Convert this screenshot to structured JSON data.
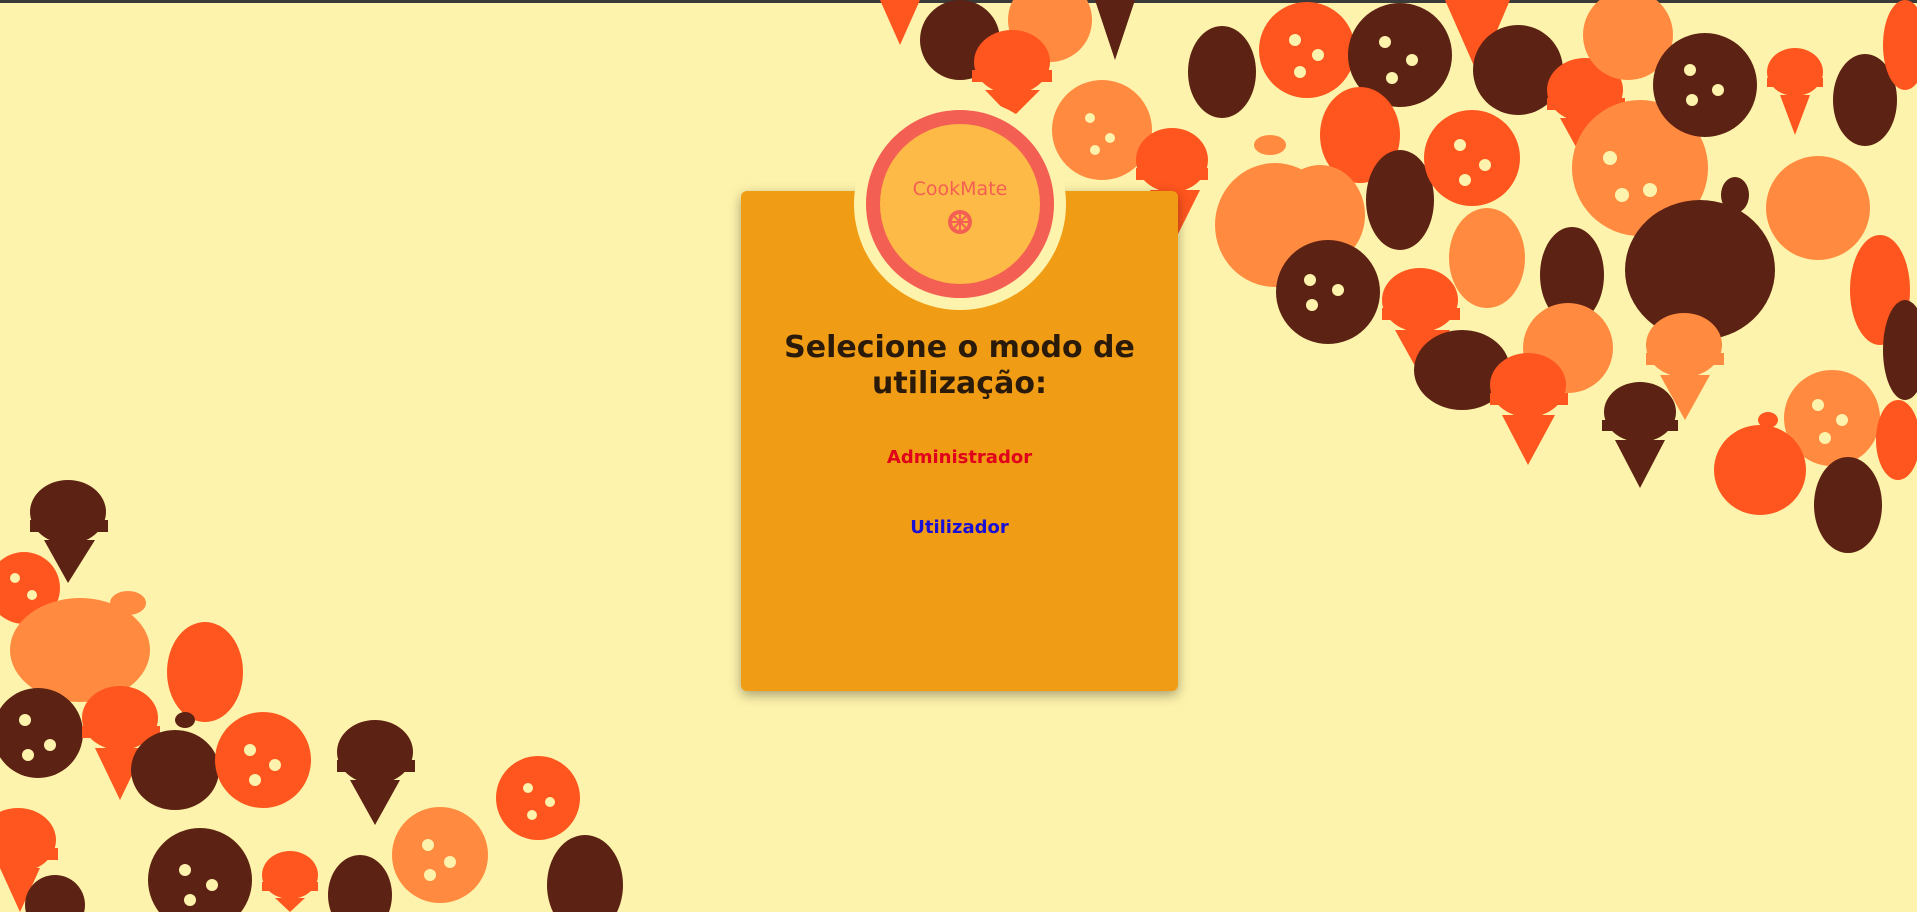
{
  "app": {
    "name": "CookMate"
  },
  "colors": {
    "background": "#FEF3AC",
    "card": "#F09C14",
    "logo_ring": "#F35F52",
    "logo_fill": "#FEBA47",
    "dark_brown": "#5C2213",
    "red_orange": "#FF551E",
    "light_orange": "#FF8A40",
    "admin_link": "#E0001B",
    "user_link": "#1A0FD6"
  },
  "icons": [
    "citrus-icon",
    "cookie-icon",
    "ice-cream-icon",
    "apple-icon",
    "egg-icon"
  ],
  "card": {
    "title": "Selecione o modo de utilização:",
    "options": [
      {
        "label": "Administrador"
      },
      {
        "label": "Utilizador"
      }
    ]
  }
}
